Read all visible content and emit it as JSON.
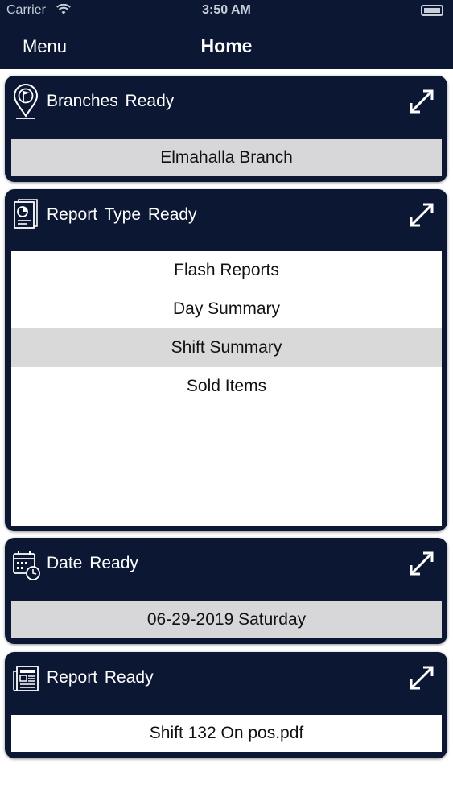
{
  "status": {
    "carrier": "Carrier",
    "time": "3:50 AM"
  },
  "nav": {
    "menu_label": "Menu",
    "title": "Home"
  },
  "branches": {
    "label": "Branches  Ready",
    "value": "Elmahalla Branch"
  },
  "report_type": {
    "label": "Report Type  Ready",
    "items": [
      {
        "label": "Flash Reports"
      },
      {
        "label": "Day Summary"
      },
      {
        "label": "Shift Summary",
        "selected": true
      },
      {
        "label": "Sold Items"
      }
    ]
  },
  "date": {
    "label": "Date  Ready",
    "value": "06-29-2019 Saturday"
  },
  "report": {
    "label": "Report  Ready",
    "value": "Shift 132 On pos.pdf"
  },
  "colors": {
    "navy": "#0b1733",
    "selected_row": "#d9d9da",
    "value_box": "#d7d7d9"
  },
  "icons": {
    "branches": "map-pin-flag-icon",
    "report_type": "report-chart-icon",
    "date": "calendar-clock-icon",
    "report": "newspaper-icon",
    "expand": "expand-arrows-icon"
  }
}
